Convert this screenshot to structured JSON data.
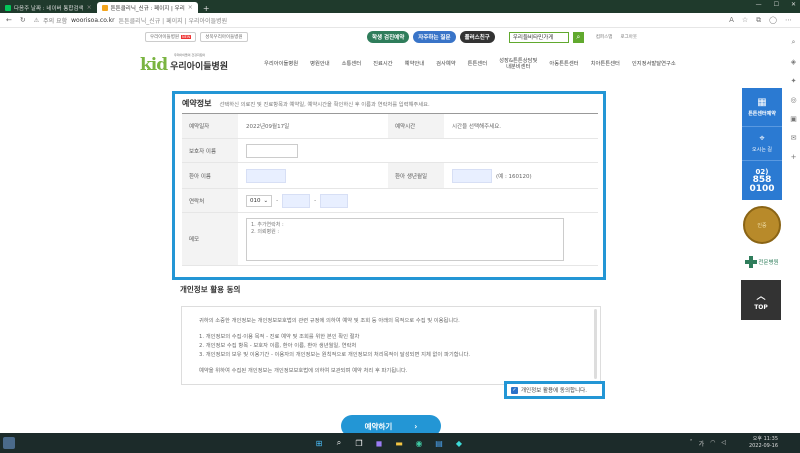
{
  "browser": {
    "tabs": [
      {
        "title": "다음주 날짜 : 네이버 통합검색",
        "color": "#03c75a"
      },
      {
        "title": "튼튼클리닉_신규 : 페이지 | 우리",
        "color": "#f3a51c"
      }
    ],
    "new_tab": "+",
    "address": {
      "warning": "주의 요함",
      "url": "woorisoa.co.kr",
      "title": "튼튼클리닉_신규 | 페이지 | 우리아이들병원"
    }
  },
  "site": {
    "mini_tabs": [
      {
        "label": "우리아이들병원",
        "badge": "NEW"
      },
      {
        "label": "성북우리아이들병원",
        "badge": ""
      }
    ],
    "top_buttons": [
      {
        "label": "학생 검진예약",
        "style": "green"
      },
      {
        "label": "자주하는 질문",
        "style": "blue"
      },
      {
        "label": "플러스친구",
        "style": "dark"
      }
    ],
    "search_placeholder": "우리들비타민가게",
    "top_links": [
      "컴퍼스맵",
      "로그아웃"
    ],
    "logo": {
      "kid": "kid",
      "name": "우리아이들병원",
      "tagline": "우리아이들의 건강지킴이"
    },
    "gnb": [
      "우리아이들병원",
      "병원안내",
      "소통센터",
      "진료시간",
      "예약안내",
      "검사예약",
      "튼튼센터",
      "성장&튼튼상담및\n내분비센터",
      "아동튼튼센터",
      "치아튼튼센터",
      "인지정서발달연구소"
    ]
  },
  "form": {
    "title": "예약정보",
    "description": "선택하신 의료진 및 진료항목과 예약일, 예약시간을 확인하신 후 이름과 연락처를 입력해주세요.",
    "date_label": "예약일자",
    "date_value": "2022년09월17일",
    "time_label": "예약시간",
    "time_placeholder": "시간을 선택해주세요.",
    "guardian_label": "보호자 이름",
    "child_name_label": "환아 이름",
    "birth_label": "환아 생년월일",
    "birth_hint": "(예 : 160120)",
    "phone_label": "연락처",
    "phone_prefix": "010",
    "phone_sep": "-",
    "memo_label": "메모",
    "memo_value": "1. 추가연락처 :\n2. 의뢰병원 :"
  },
  "consent": {
    "title": "개인정보 활용 동의",
    "lines": [
      "귀하의 소중한 개인정보는 개인정보보호법의 관련 규정에 의하여 예약 및 조회 등 아래의 목적으로 수집 및 이용됩니다.",
      "1. 개인정보의 수집·이용 목적 - 진료 예약 및 조회를 위한 본인 확인 절차",
      "2. 개인정보 수집 항목 - 보호자 이름, 환아 이름, 환아 생년월일, 연락처",
      "3. 개인정보의 보유 및 이용기간 - 이용자의 개인정보는 원칙적으로 개인정보의 처리목적이 달성되면 지체 없이 파기합니다.",
      "예약을 위하여 수집된 개인정보는 개인정보보호법에 의하여 보관되며 예약 처리 후 파기됩니다."
    ],
    "agree_label": "개인정보 활용에 동의합니다.",
    "agree_checked": true
  },
  "reserve_button": {
    "label": "예약하기",
    "arrow": "›"
  },
  "quick": {
    "reserve_label": "튼튼센터예약",
    "way_label": "오시는 길",
    "tel_area": "02)",
    "tel_1": "858",
    "tel_2": "0100",
    "seal_text": "인증",
    "hospital_label": "전문병원",
    "top_label": "TOP"
  },
  "taskbar": {
    "time": "오후 11:35",
    "date": "2022-09-16"
  }
}
